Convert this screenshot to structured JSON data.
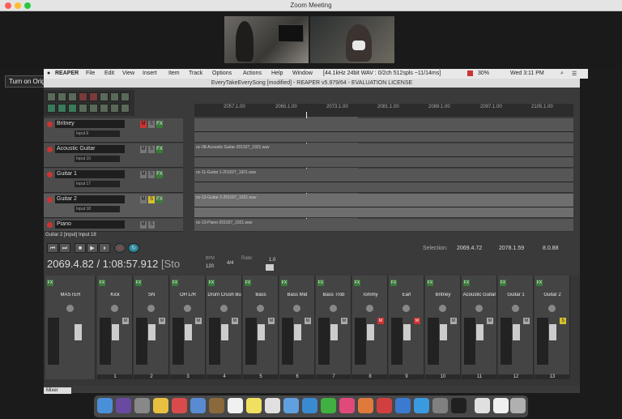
{
  "zoom": {
    "title": "Zoom Meeting"
  },
  "menubar": {
    "app": "REAPER",
    "items": [
      "File",
      "Edit",
      "View",
      "Insert",
      "Item",
      "Track",
      "Options",
      "Actions",
      "Help",
      "Window"
    ],
    "status": "[44.1kHz 24bit WAV : 0/2ch 512spls ~11/14ms]",
    "battery": "30%",
    "clock": "Wed 3:11 PM"
  },
  "window": {
    "title": "EveryTakeEverySong [modified] - REAPER v5.979/64 - EVALUATION LICENSE"
  },
  "tooltip": {
    "label": "Turn on Original Sound",
    "caret": "▾"
  },
  "tracks": [
    {
      "name": "Britney",
      "input": "Input 6"
    },
    {
      "name": "Acoustic Guitar",
      "input": "Input 10"
    },
    {
      "name": "Guitar 1",
      "input": "Input 17"
    },
    {
      "name": "Guitar 2",
      "input": "Input 18"
    },
    {
      "name": "Piano",
      "input": ""
    }
  ],
  "lanes": [
    {
      "label": ""
    },
    {
      "label": "oc-08-Acoustic Guitar-201027_1921.wav"
    },
    {
      "label": "oc-11-Guitar 1-201027_1921.wav"
    },
    {
      "label": "oc-12-Guitar 2-201027_1921.wav"
    },
    {
      "label": "oc-13-Piano-201027_1921.wav"
    }
  ],
  "ruler": [
    "2057.1.00",
    "2065.1.00",
    "2073.1.00",
    "2081.1.00",
    "2089.1.00",
    "2097.1.00",
    "2105.1.00"
  ],
  "selected_track_info": "Guitar 2 [input] Input 18",
  "transport": {
    "time": "2069.4.82 / 1:08:57.912",
    "state": "[Sto",
    "selection_label": "Selection:",
    "sel_start": "2069.4.72",
    "sel_end": "2078.1.59",
    "sel_len": "8.0.88",
    "bpm_label": "BPM",
    "bpm": "120",
    "timesig": "4/4",
    "rate_label": "Rate:",
    "rate": "1.0"
  },
  "mixer_tab": "Mixer",
  "strips": [
    {
      "name": "MASTER",
      "num": ""
    },
    {
      "name": "Kick",
      "num": "1"
    },
    {
      "name": "SN",
      "num": "2"
    },
    {
      "name": "OH L/R",
      "num": "3"
    },
    {
      "name": "Drum Crush Bu",
      "num": "4"
    },
    {
      "name": "Bass",
      "num": "5"
    },
    {
      "name": "Bass Mid",
      "num": "6"
    },
    {
      "name": "Bass Trob",
      "num": "7"
    },
    {
      "name": "Tommy",
      "num": "8"
    },
    {
      "name": "Earl",
      "num": "9"
    },
    {
      "name": "Britney",
      "num": "10"
    },
    {
      "name": "Acoustic Guitar",
      "num": "11"
    },
    {
      "name": "Guitar 1",
      "num": "12"
    },
    {
      "name": "Guitar 2",
      "num": "13"
    }
  ],
  "colors": {
    "accent_red": "#cc3333",
    "fx_green": "#3a7a3a",
    "window_bg": "#3a3a3a"
  }
}
